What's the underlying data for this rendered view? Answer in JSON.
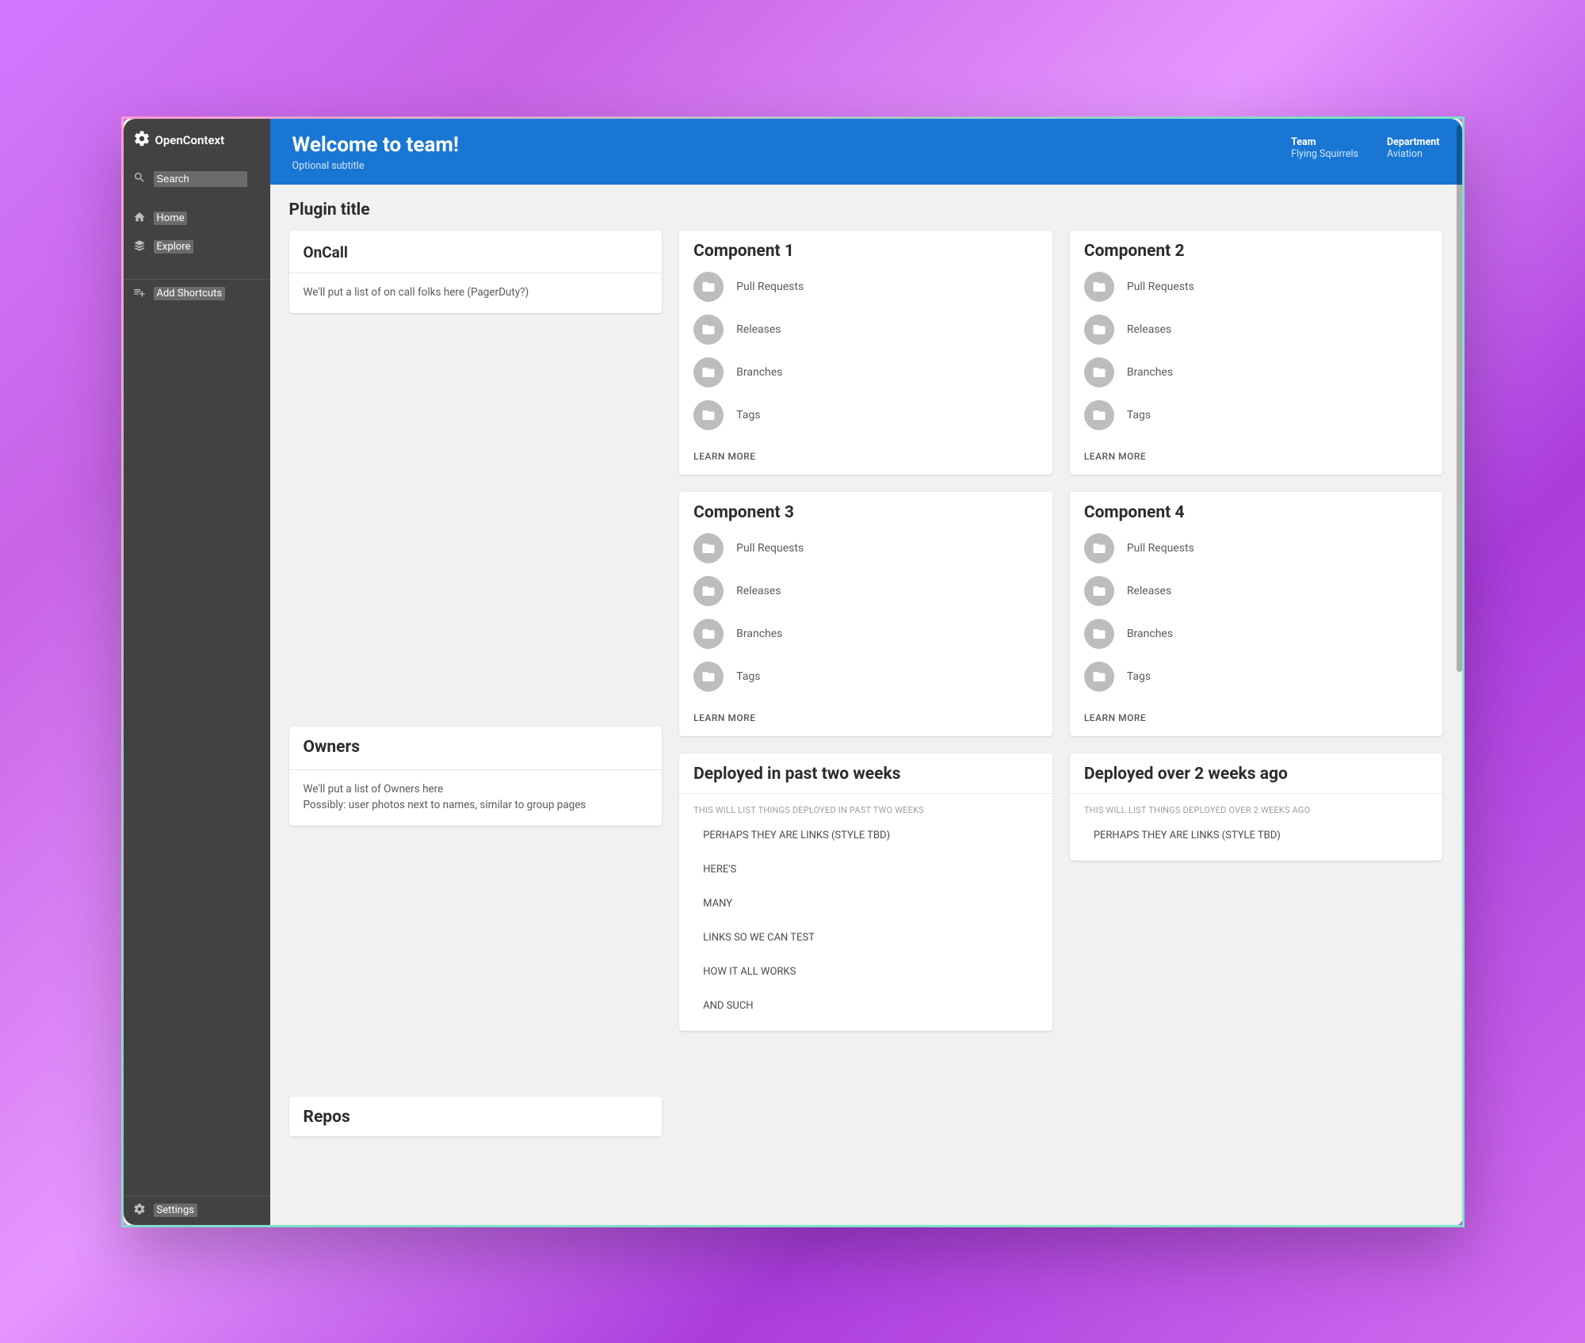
{
  "brand": "OpenContext",
  "sidebar": {
    "search_placeholder": "Search",
    "items": [
      {
        "label": "Home",
        "icon": "home-icon"
      },
      {
        "label": "Explore",
        "icon": "layers-icon"
      }
    ],
    "shortcuts_label": "Add Shortcuts",
    "settings_label": "Settings"
  },
  "header": {
    "title": "Welcome to team!",
    "subtitle": "Optional subtitle",
    "meta": [
      {
        "label": "Team",
        "value": "Flying Squirrels"
      },
      {
        "label": "Department",
        "value": "Aviation"
      }
    ]
  },
  "section_title": "Plugin title",
  "cards": {
    "oncall": {
      "title": "OnCall",
      "body": "We'll put a list of on call folks here (PagerDuty?)"
    },
    "owners": {
      "title": "Owners",
      "body": "We'll put a list of Owners here\nPossibly: user photos next to names, similar to group pages"
    },
    "repos": {
      "title": "Repos"
    },
    "components": [
      {
        "title": "Component 1",
        "items": [
          "Pull Requests",
          "Releases",
          "Branches",
          "Tags"
        ],
        "action": "LEARN MORE"
      },
      {
        "title": "Component 2",
        "items": [
          "Pull Requests",
          "Releases",
          "Branches",
          "Tags"
        ],
        "action": "LEARN MORE"
      },
      {
        "title": "Component 3",
        "items": [
          "Pull Requests",
          "Releases",
          "Branches",
          "Tags"
        ],
        "action": "LEARN MORE"
      },
      {
        "title": "Component 4",
        "items": [
          "Pull Requests",
          "Releases",
          "Branches",
          "Tags"
        ],
        "action": "LEARN MORE"
      }
    ],
    "deployed_recent": {
      "title": "Deployed in past two weeks",
      "subtitle": "THIS WILL LIST THINGS DEPLOYED IN PAST TWO WEEKS",
      "links": [
        "PERHAPS THEY ARE LINKS (STYLE TBD)",
        "HERE'S",
        "MANY",
        "LINKS SO WE CAN TEST",
        "HOW IT ALL WORKS",
        "AND SUCH"
      ]
    },
    "deployed_old": {
      "title": "Deployed over 2 weeks ago",
      "subtitle": "THIS WILL LIST THINGS DEPLOYED OVER 2 WEEKS AGO",
      "links": [
        "PERHAPS THEY ARE LINKS (STYLE TBD)"
      ]
    }
  }
}
